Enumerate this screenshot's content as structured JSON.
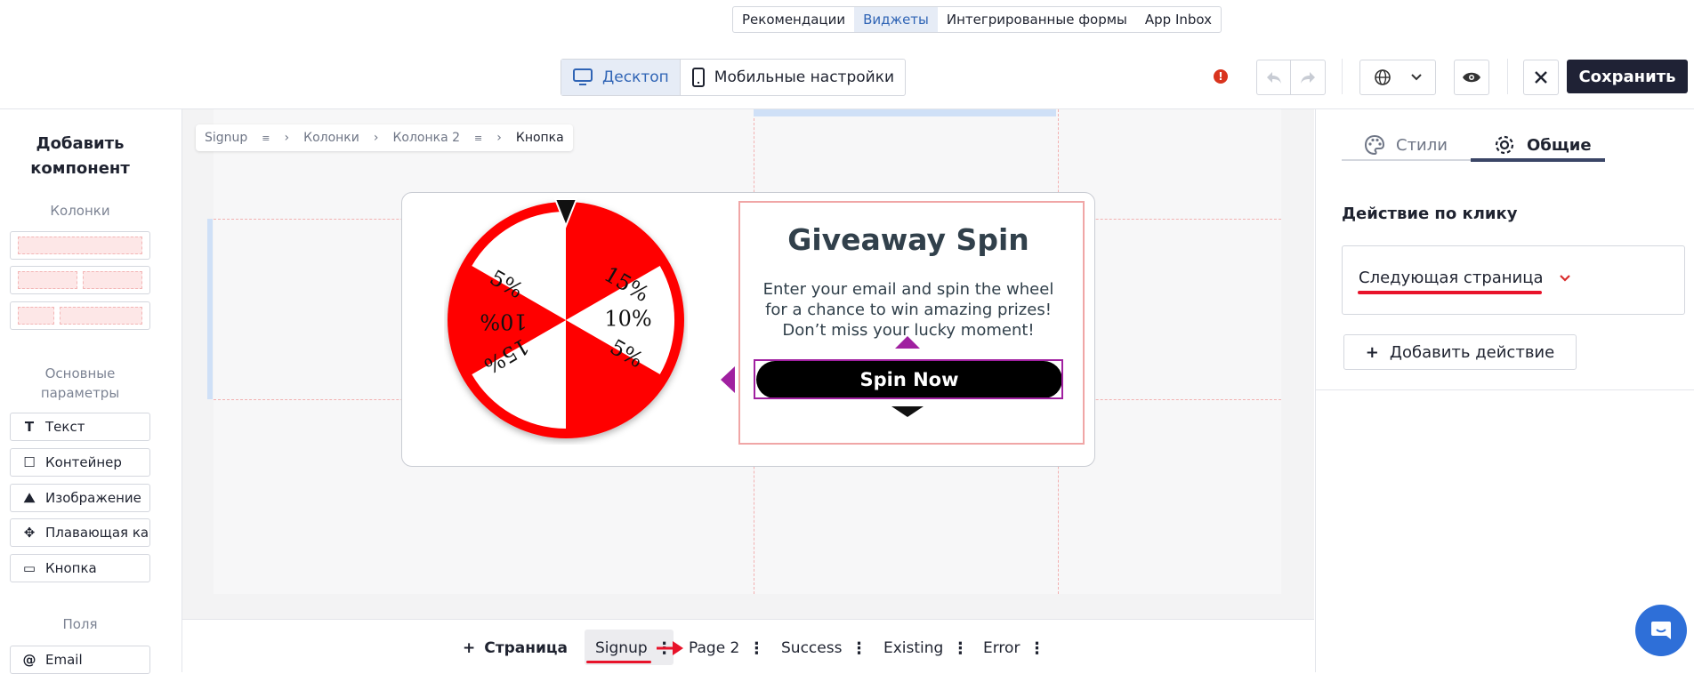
{
  "top_tabs": [
    "Рекомендации",
    "Виджеты",
    "Интегрированные формы",
    "App Inbox"
  ],
  "device": {
    "desktop": "Десктоп",
    "mobile": "Мобильные настройки"
  },
  "toolbar": {
    "warning": "!",
    "save": "Сохранить"
  },
  "left_panel": {
    "title": "Добавить компонент",
    "columns_label": "Колонки",
    "basic_label": "Основные параметры",
    "components": [
      {
        "icon": "T",
        "label": "Текст"
      },
      {
        "icon": "☐",
        "label": "Контейнер"
      },
      {
        "icon": "⛰",
        "label": "Изображение"
      },
      {
        "icon": "✥",
        "label": "Плавающая ка"
      },
      {
        "icon": "▭",
        "label": "Кнопка"
      }
    ],
    "fields_label": "Поля",
    "fields": [
      {
        "icon": "@",
        "label": "Email"
      }
    ]
  },
  "breadcrumb": [
    "Signup",
    "Колонки",
    "Колонка 2",
    "Кнопка"
  ],
  "widget": {
    "title": "Giveaway Spin",
    "description": "Enter your email and spin the wheel for a chance to win amazing prizes! Don’t miss your lucky moment!",
    "button": "Spin Now",
    "wheel_segments": [
      "5%",
      "10%",
      "15%",
      "5%",
      "10%",
      "15%"
    ]
  },
  "pages": {
    "add": "Страница",
    "items": [
      "Signup",
      "Page 2",
      "Success",
      "Existing",
      "Error"
    ]
  },
  "right_panel": {
    "tabs": [
      "Стили",
      "Общие"
    ],
    "section_title": "Действие по клику",
    "dropdown_value": "Следующая страница",
    "add_action": "Добавить действие"
  },
  "colors": {
    "accent": "#2f64b5",
    "save_bg": "#1f2235",
    "wheel_red": "#ff0000",
    "annotation_red": "#e8132a",
    "select_purple": "#a020a0"
  }
}
